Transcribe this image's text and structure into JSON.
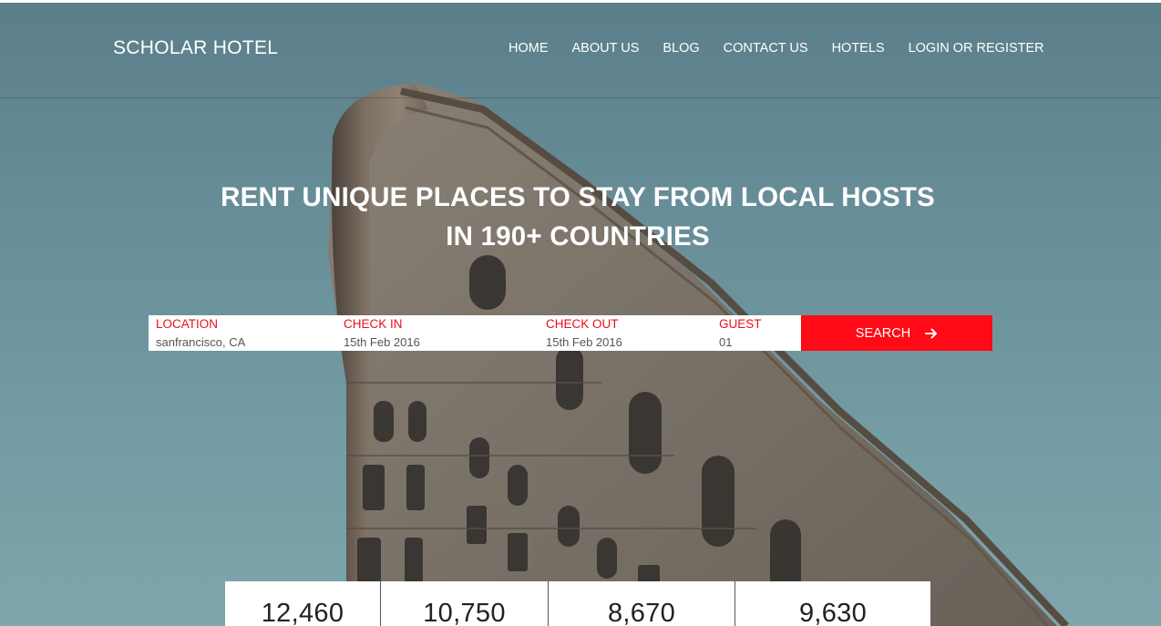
{
  "brand": "SCHOLAR HOTEL",
  "nav": [
    {
      "label": "HOME"
    },
    {
      "label": "ABOUT US"
    },
    {
      "label": "BLOG"
    },
    {
      "label": "CONTACT US"
    },
    {
      "label": "HOTELS"
    },
    {
      "label": "LOGIN OR REGISTER"
    }
  ],
  "headline": {
    "line1": "RENT UNIQUE PLACES TO STAY FROM LOCAL HOSTS",
    "line2": "IN 190+ COUNTRIES"
  },
  "search": {
    "location": {
      "label": "LOCATION",
      "value": "sanfrancisco, CA"
    },
    "check_in": {
      "label": "CHECK IN",
      "value": "15th Feb 2016"
    },
    "check_out": {
      "label": "CHECK OUT",
      "value": "15th Feb 2016"
    },
    "guest": {
      "label": "GUEST",
      "value": "01"
    },
    "button_label": "SEARCH",
    "button_icon": "arrow-right-icon"
  },
  "stats": [
    {
      "value": "12,460"
    },
    {
      "value": "10,750"
    },
    {
      "value": "8,670"
    },
    {
      "value": "9,630"
    }
  ],
  "colors": {
    "accent": "#ff0a16",
    "label_red": "#e8101c",
    "text_white": "#ffffff"
  }
}
